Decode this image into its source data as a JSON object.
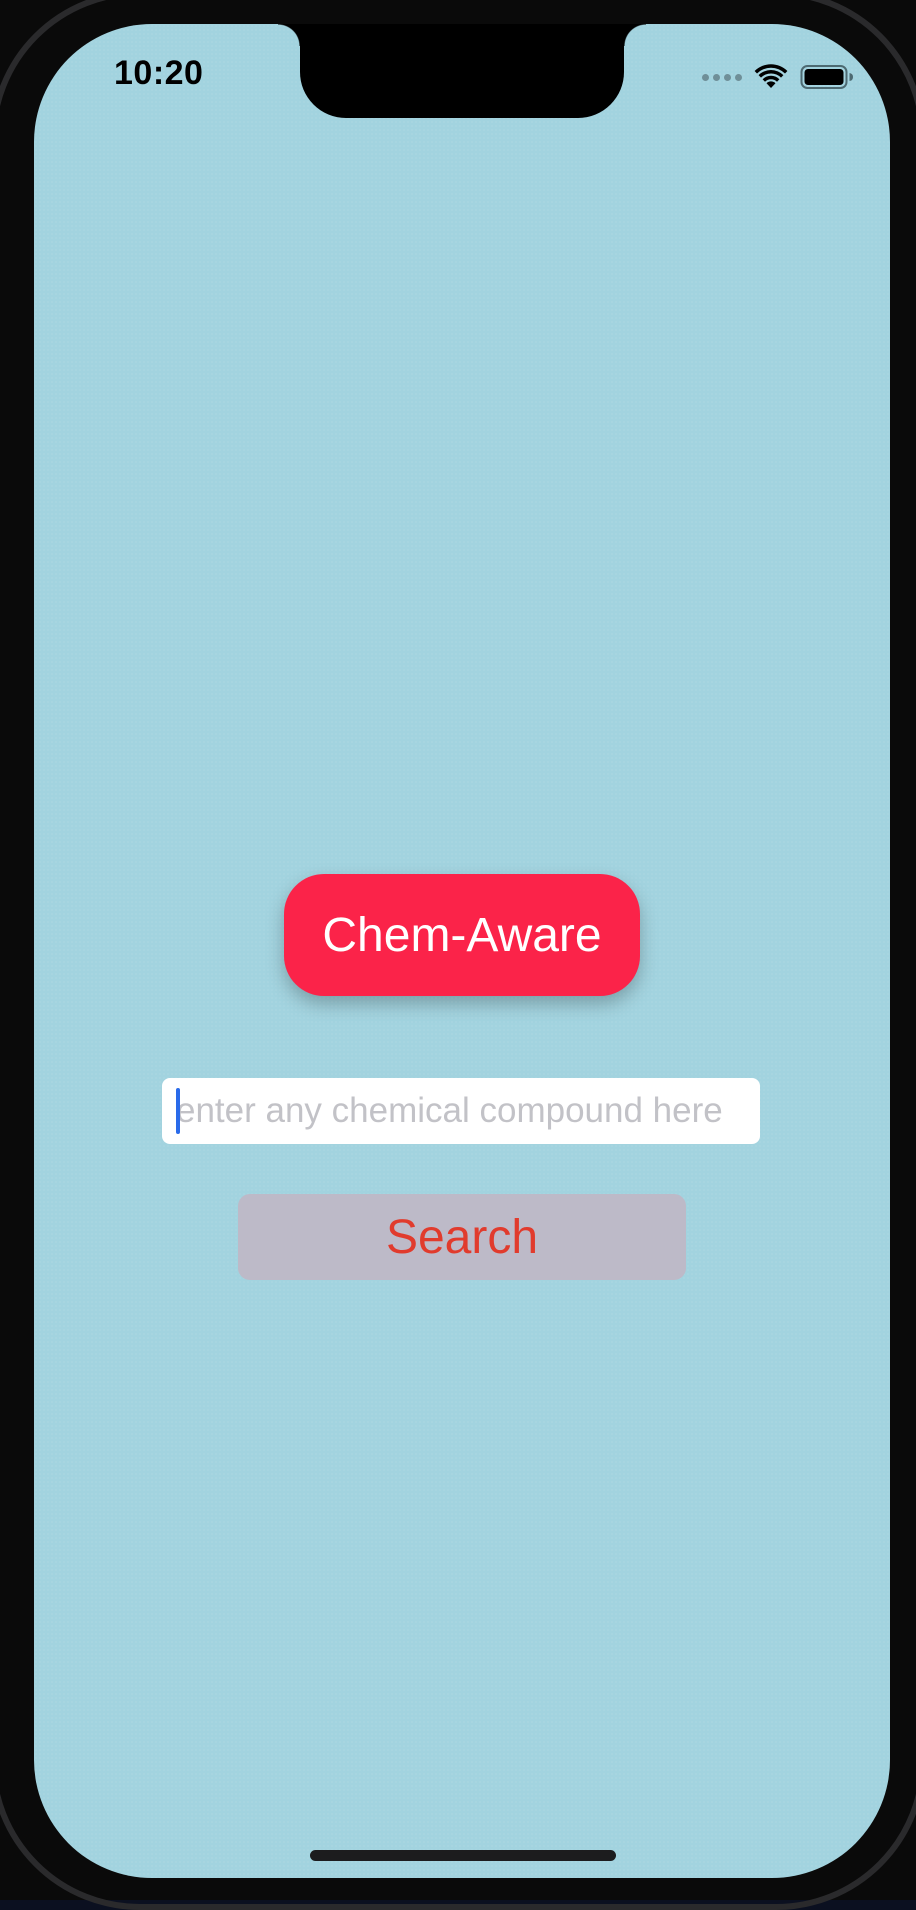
{
  "status_bar": {
    "time": "10:20",
    "icons": [
      "cellular-signal-icon",
      "wifi-icon",
      "battery-icon"
    ]
  },
  "app": {
    "title": "Chem-Aware",
    "search_input": {
      "placeholder": "enter any chemical compound here",
      "value": ""
    },
    "search_button_label": "Search"
  },
  "colors": {
    "background": "#a2d3df",
    "title_badge": "#fb2349",
    "title_text": "#ffffff",
    "button_background": "#bdbac8",
    "button_text": "#e13b2d",
    "caret": "#2a6bea"
  }
}
